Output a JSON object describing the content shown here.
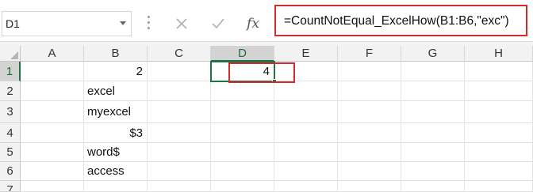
{
  "name_box": {
    "value": "D1"
  },
  "formula_bar": {
    "formula": "=CountNotEqual_ExcelHow(B1:B6,\"exc\")",
    "cancel_icon": "close-icon",
    "enter_icon": "check-icon",
    "function_icon_label": "fx"
  },
  "columns": [
    "A",
    "B",
    "C",
    "D",
    "E",
    "F",
    "G",
    "H"
  ],
  "rows": [
    "1",
    "2",
    "3",
    "4",
    "5",
    "6",
    "7"
  ],
  "selected": {
    "column": "D",
    "row": "1"
  },
  "cells": {
    "B1": "2",
    "B2": "excel",
    "B3": "myexcel",
    "B4": "$3",
    "B5": "word$",
    "B6": "access",
    "D1": "4"
  },
  "colors": {
    "highlight": "#d42a2a",
    "selection": "#217346"
  }
}
